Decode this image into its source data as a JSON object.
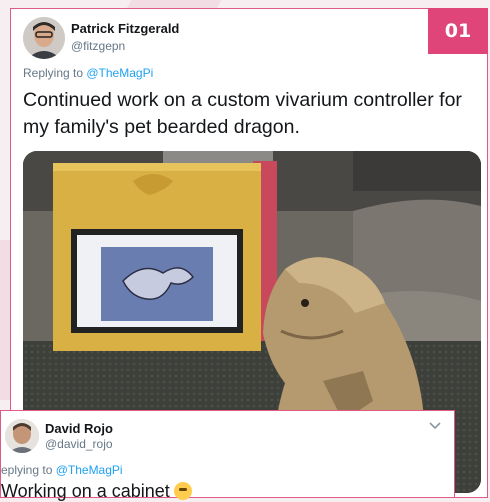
{
  "badge": "01",
  "main_tweet": {
    "author_name": "Patrick Fitzgerald",
    "handle": "@fitzgepn",
    "replying_prefix": "Replying to ",
    "replying_to": "@TheMagPi",
    "text": "Continued work on a custom vivarium controller for my family's pet bearded dragon.",
    "media_icon": "photo-bearded-dragon-vivarium-controller"
  },
  "reply_tweet": {
    "author_name": "David Rojo",
    "handle": "@david_rojo",
    "replying_prefix": "eplying to ",
    "replying_to": "@TheMagPi",
    "text": "Working on a cabinet",
    "emoji_icon": "grimace-emoji-icon",
    "menu_icon": "chevron-down-icon"
  },
  "colors": {
    "accent": "#e0457a",
    "border": "#e05a86",
    "link": "#1da1f2",
    "muted": "#657786"
  }
}
